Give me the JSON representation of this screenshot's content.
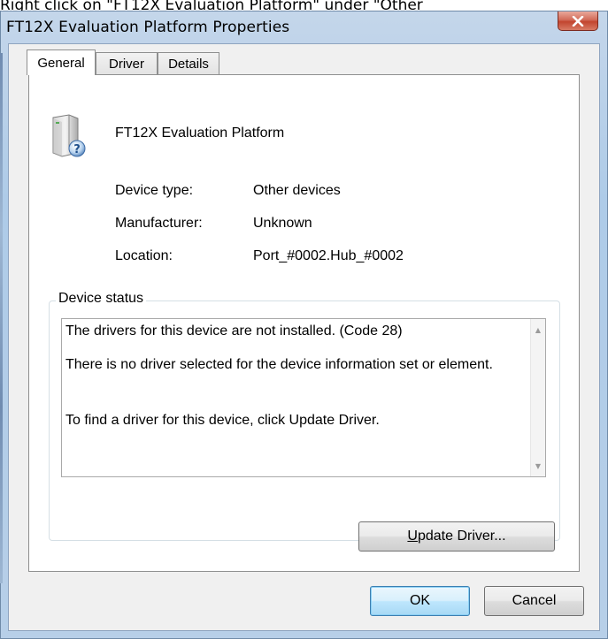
{
  "caption": {
    "text": "Right click on \"FT12X Evaluation Platform\" under \"Other"
  },
  "window": {
    "title": "FT12X Evaluation Platform Properties",
    "close_glyph": "x"
  },
  "tabs": [
    {
      "label": "General",
      "active": true
    },
    {
      "label": "Driver",
      "active": false
    },
    {
      "label": "Details",
      "active": false
    }
  ],
  "device": {
    "icon": "unknown-device-icon",
    "name": "FT12X Evaluation Platform"
  },
  "properties": {
    "device_type_label": "Device type:",
    "device_type_value": "Other devices",
    "manufacturer_label": "Manufacturer:",
    "manufacturer_value": "Unknown",
    "location_label": "Location:",
    "location_value": "Port_#0002.Hub_#0002"
  },
  "device_status": {
    "title": "Device status",
    "line1": "The drivers for this device are not installed. (Code 28)",
    "line2": "There is no driver selected for the device information set or element.",
    "line3": "To find a driver for this device, click Update Driver."
  },
  "buttons": {
    "update_driver_accel": "U",
    "update_driver_rest": "pdate Driver...",
    "ok": "OK",
    "cancel": "Cancel"
  }
}
